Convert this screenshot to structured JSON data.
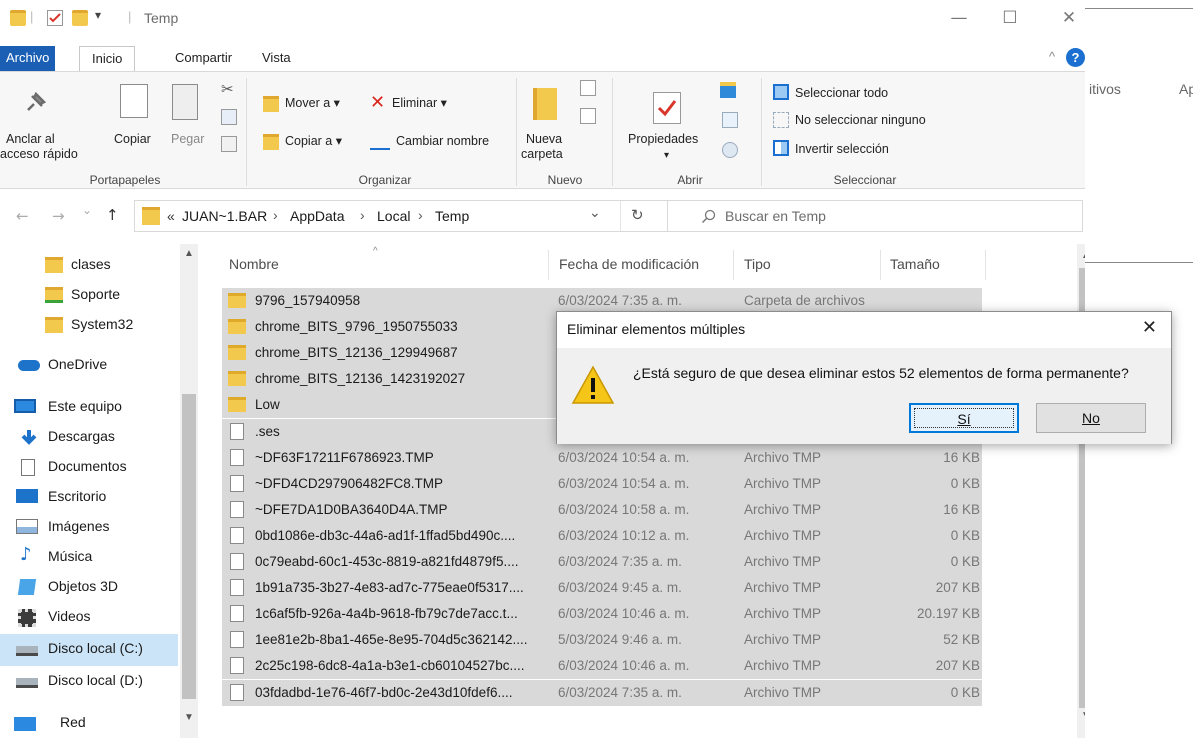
{
  "window": {
    "title": "Temp",
    "qat_separator": "|",
    "minimize": "—",
    "maximize": "☐",
    "close": "✕",
    "collapse": "^",
    "help": "?"
  },
  "menu": [
    "Archivo",
    "Inicio",
    "Compartir",
    "Vista"
  ],
  "ribbon": {
    "pin_label_1": "Anclar al",
    "pin_label_2": "acceso rápido",
    "copy": "Copiar",
    "paste": "Pegar",
    "clipboard_group": "Portapapeles",
    "move_to": "Mover a ▾",
    "copy_to": "Copiar a ▾",
    "delete": "Eliminar ▾",
    "rename": "Cambiar nombre",
    "organize_group": "Organizar",
    "new_folder_1": "Nueva",
    "new_folder_2": "carpeta",
    "new_group": "Nuevo",
    "properties": "Propiedades",
    "properties_arrow": "▾",
    "open_group": "Abrir",
    "select_all": "Seleccionar todo",
    "select_none": "No seleccionar ninguno",
    "invert_selection": "Invertir selección",
    "select_group": "Seleccionar"
  },
  "nav": {
    "back": "←",
    "forward": "→",
    "recent": "⌄",
    "up": "↑",
    "overflow": "«",
    "path": [
      "JUAN~1.BAR",
      "AppData",
      "Local",
      "Temp"
    ],
    "path_sep": "›",
    "dropdown": "⌄",
    "refresh": "↻",
    "search_placeholder": "Buscar en Temp"
  },
  "sidebar": [
    {
      "label": "clases",
      "icon": "folder-icon"
    },
    {
      "label": "Soporte",
      "icon": "pinned-folder-icon"
    },
    {
      "label": "System32",
      "icon": "folder-icon"
    },
    {
      "label": "OneDrive",
      "icon": "cloud-icon"
    },
    {
      "label": "Este equipo",
      "icon": "computer-icon"
    },
    {
      "label": "Descargas",
      "icon": "download-icon"
    },
    {
      "label": "Documentos",
      "icon": "document-icon"
    },
    {
      "label": "Escritorio",
      "icon": "desktop-icon"
    },
    {
      "label": "Imágenes",
      "icon": "pictures-icon"
    },
    {
      "label": "Música",
      "icon": "music-icon"
    },
    {
      "label": "Objetos 3D",
      "icon": "cube-icon"
    },
    {
      "label": "Videos",
      "icon": "video-icon"
    },
    {
      "label": "Disco local (C:)",
      "icon": "drive-icon"
    },
    {
      "label": "Disco local (D:)",
      "icon": "drive-icon"
    },
    {
      "label": "Red",
      "icon": "network-icon"
    }
  ],
  "columns": {
    "name": "Nombre",
    "date": "Fecha de modificación",
    "type": "Tipo",
    "size": "Tamaño"
  },
  "files": [
    {
      "name": "9796_157940958",
      "date": "6/03/2024 7:35 a. m.",
      "type": "Carpeta de archivos",
      "size": "",
      "kind": "folder"
    },
    {
      "name": "chrome_BITS_9796_1950755033",
      "date": "",
      "type": "",
      "size": "",
      "kind": "folder"
    },
    {
      "name": "chrome_BITS_12136_129949687",
      "date": "",
      "type": "",
      "size": "",
      "kind": "folder"
    },
    {
      "name": "chrome_BITS_12136_1423192027",
      "date": "",
      "type": "",
      "size": "",
      "kind": "folder"
    },
    {
      "name": "Low",
      "date": "",
      "type": "",
      "size": "",
      "kind": "folder"
    },
    {
      "name": ".ses",
      "date": "",
      "type": "",
      "size": "",
      "kind": "file"
    },
    {
      "name": "~DF63F17211F6786923.TMP",
      "date": "6/03/2024 10:54 a. m.",
      "type": "Archivo TMP",
      "size": "16 KB",
      "kind": "file"
    },
    {
      "name": "~DFD4CD297906482FC8.TMP",
      "date": "6/03/2024 10:54 a. m.",
      "type": "Archivo TMP",
      "size": "0 KB",
      "kind": "file"
    },
    {
      "name": "~DFE7DA1D0BA3640D4A.TMP",
      "date": "6/03/2024 10:58 a. m.",
      "type": "Archivo TMP",
      "size": "16 KB",
      "kind": "file"
    },
    {
      "name": "0bd1086e-db3c-44a6-ad1f-1ffad5bd490c....",
      "date": "6/03/2024 10:12 a. m.",
      "type": "Archivo TMP",
      "size": "0 KB",
      "kind": "file"
    },
    {
      "name": "0c79eabd-60c1-453c-8819-a821fd4879f5....",
      "date": "6/03/2024 7:35 a. m.",
      "type": "Archivo TMP",
      "size": "0 KB",
      "kind": "file"
    },
    {
      "name": "1b91a735-3b27-4e83-ad7c-775eae0f5317....",
      "date": "6/03/2024 9:45 a. m.",
      "type": "Archivo TMP",
      "size": "207 KB",
      "kind": "file"
    },
    {
      "name": "1c6af5fb-926a-4a4b-9618-fb79c7de7acc.t...",
      "date": "6/03/2024 10:46 a. m.",
      "type": "Archivo TMP",
      "size": "20.197 KB",
      "kind": "file"
    },
    {
      "name": "1ee81e2b-8ba1-465e-8e95-704d5c362142....",
      "date": "5/03/2024 9:46 a. m.",
      "type": "Archivo TMP",
      "size": "52 KB",
      "kind": "file"
    },
    {
      "name": "2c25c198-6dc8-4a1a-b3e1-cb60104527bc....",
      "date": "6/03/2024 10:46 a. m.",
      "type": "Archivo TMP",
      "size": "207 KB",
      "kind": "file"
    },
    {
      "name": "03fdadbd-1e76-46f7-bd0c-2e43d10fdef6....",
      "date": "6/03/2024 7:35 a. m.",
      "type": "Archivo TMP",
      "size": "0 KB",
      "kind": "file"
    }
  ],
  "right_pane": {
    "text_1": "itivos",
    "text_2": "Ap"
  },
  "dialog": {
    "title": "Eliminar elementos múltiples",
    "close": "✕",
    "message": "¿Está seguro de que desea eliminar estos 52 elementos de forma permanente?",
    "yes": "Sí",
    "no": "No"
  },
  "colors": {
    "accent": "#1a5fb4",
    "selection": "#d9d9d9",
    "folder": "#f2c94c",
    "warning": "#f5c518"
  }
}
